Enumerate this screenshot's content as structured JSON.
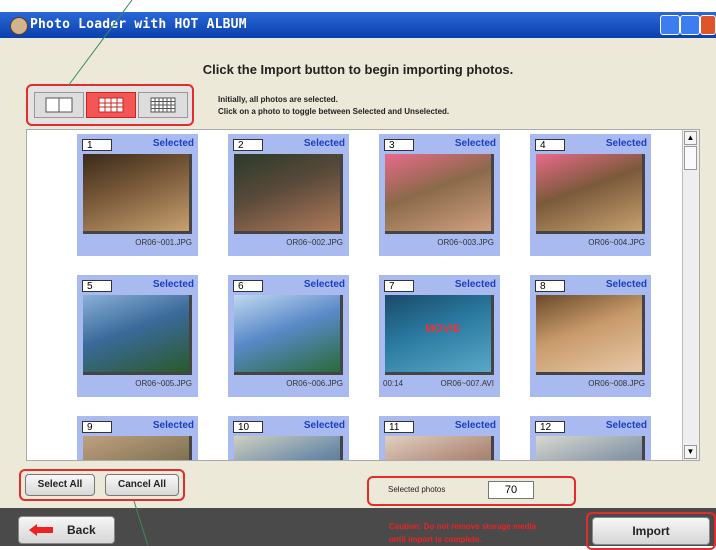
{
  "window": {
    "title": "Photo Loader with HOT ALBUM"
  },
  "header": {
    "text": "Click the Import button to begin importing photos."
  },
  "instructions": {
    "line1": "Initially, all photos are selected.",
    "line2": "Click on a photo to toggle between Selected and Unselected."
  },
  "view_modes": [
    "large-view",
    "medium-grid-view",
    "small-grid-view"
  ],
  "active_view": "medium-grid-view",
  "photos": [
    {
      "num": "1",
      "status": "Selected",
      "file": "OR06~001.JPG",
      "duration": ""
    },
    {
      "num": "2",
      "status": "Selected",
      "file": "OR06~002.JPG",
      "duration": ""
    },
    {
      "num": "3",
      "status": "Selected",
      "file": "OR06~003.JPG",
      "duration": ""
    },
    {
      "num": "4",
      "status": "Selected",
      "file": "OR06~004.JPG",
      "duration": ""
    },
    {
      "num": "5",
      "status": "Selected",
      "file": "OR06~005.JPG",
      "duration": ""
    },
    {
      "num": "6",
      "status": "Selected",
      "file": "OR06~006.JPG",
      "duration": ""
    },
    {
      "num": "7",
      "status": "Selected",
      "file": "OR06~007.AVI",
      "duration": "00:14",
      "overlay": "MOVIE"
    },
    {
      "num": "8",
      "status": "Selected",
      "file": "OR06~008.JPG",
      "duration": ""
    },
    {
      "num": "9",
      "status": "Selected",
      "file": "",
      "duration": ""
    },
    {
      "num": "10",
      "status": "Selected",
      "file": "",
      "duration": ""
    },
    {
      "num": "11",
      "status": "Selected",
      "file": "",
      "duration": ""
    },
    {
      "num": "12",
      "status": "Selected",
      "file": "",
      "duration": ""
    }
  ],
  "buttons": {
    "select_all": "Select All",
    "cancel_all": "Cancel All",
    "back": "Back",
    "import": "Import"
  },
  "selected_count": {
    "label": "Selected photos",
    "value": "70"
  },
  "caution": {
    "line1": "Caution: Do not remove storage media",
    "line2": "until import is complete."
  },
  "colors": {
    "titlebar": "#0a3fae",
    "highlight": "#e32c2c",
    "tile": "#a9baf0",
    "selected_text": "#1b3fbe"
  }
}
